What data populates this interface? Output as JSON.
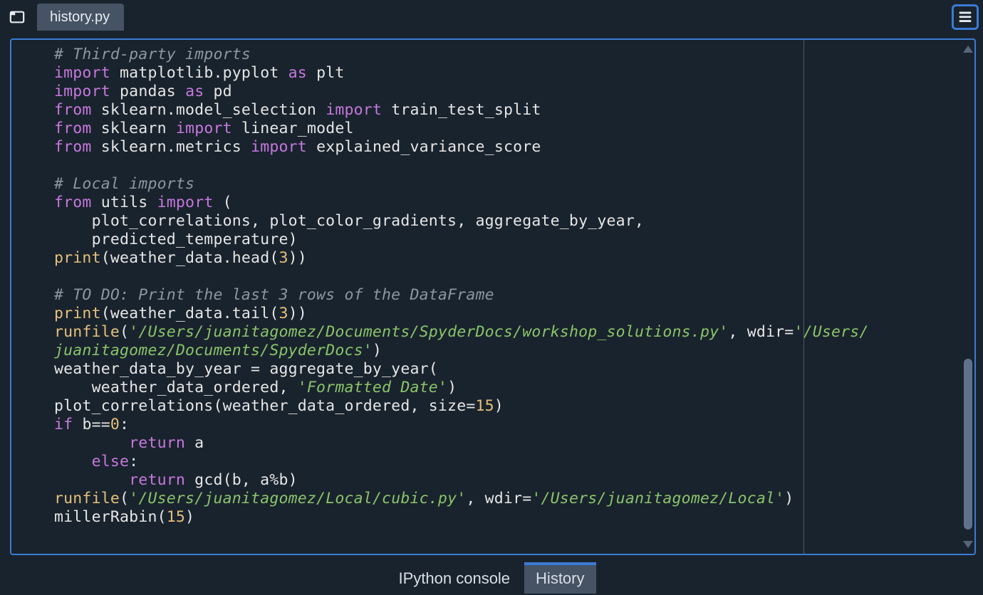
{
  "tab": {
    "filename": "history.py"
  },
  "bottom_tabs": {
    "ipython": "IPython console",
    "history": "History",
    "active": "History"
  },
  "code": {
    "l01_comment": "# Third-party imports",
    "l02_import": "import",
    "l02_mod": "matplotlib.pyplot",
    "l02_as": "as",
    "l02_alias": "plt",
    "l03_import": "import",
    "l03_mod": "pandas",
    "l03_as": "as",
    "l03_alias": "pd",
    "l04_from": "from",
    "l04_mod": "sklearn.model_selection",
    "l04_import": "import",
    "l04_name": "train_test_split",
    "l05_from": "from",
    "l05_mod": "sklearn",
    "l05_import": "import",
    "l05_name": "linear_model",
    "l06_from": "from",
    "l06_mod": "sklearn.metrics",
    "l06_import": "import",
    "l06_name": "explained_variance_score",
    "l07_blank": "",
    "l08_comment": "# Local imports",
    "l09_from": "from",
    "l09_mod": "utils",
    "l09_import": "import",
    "l09_paren": "(",
    "l10_names": "    plot_correlations, plot_color_gradients, aggregate_by_year,",
    "l11_names": "    predicted_temperature)",
    "l12_print": "print",
    "l12_open": "(",
    "l12_obj": "weather_data.head(",
    "l12_num": "3",
    "l12_close": "))",
    "l13_blank": "",
    "l14_comment": "# TO DO: Print the last 3 rows of the DataFrame",
    "l15_print": "print",
    "l15_open": "(",
    "l15_obj": "weather_data.tail(",
    "l15_num": "3",
    "l15_close": "))",
    "l16_run": "runfile",
    "l16_open": "(",
    "l16_str1": "'/Users/juanitagomez/Documents/SpyderDocs/workshop_solutions.py'",
    "l16_mid": ", wdir=",
    "l16_str2": "'/Users/",
    "l17_strcont": "juanitagomez/Documents/SpyderDocs'",
    "l17_close": ")",
    "l18_line": "weather_data_by_year = aggregate_by_year(",
    "l19_indent": "    weather_data_ordered, ",
    "l19_str": "'Formatted Date'",
    "l19_close": ")",
    "l20_call": "plot_correlations(weather_data_ordered, size=",
    "l20_num": "15",
    "l20_close": ")",
    "l21_if": "if",
    "l21_cond": " b==",
    "l21_num": "0",
    "l21_colon": ":",
    "l22_return": "        return",
    "l22_var": " a",
    "l23_else": "    else",
    "l23_colon": ":",
    "l24_return": "        return",
    "l24_call": " gcd(b, a%b)",
    "l25_run": "runfile",
    "l25_open": "(",
    "l25_str1": "'/Users/juanitagomez/Local/cubic.py'",
    "l25_mid": ", wdir=",
    "l25_str2": "'/Users/juanitagomez/Local'",
    "l25_close": ")",
    "l26_call": "millerRabin(",
    "l26_num": "15",
    "l26_close": ")"
  }
}
